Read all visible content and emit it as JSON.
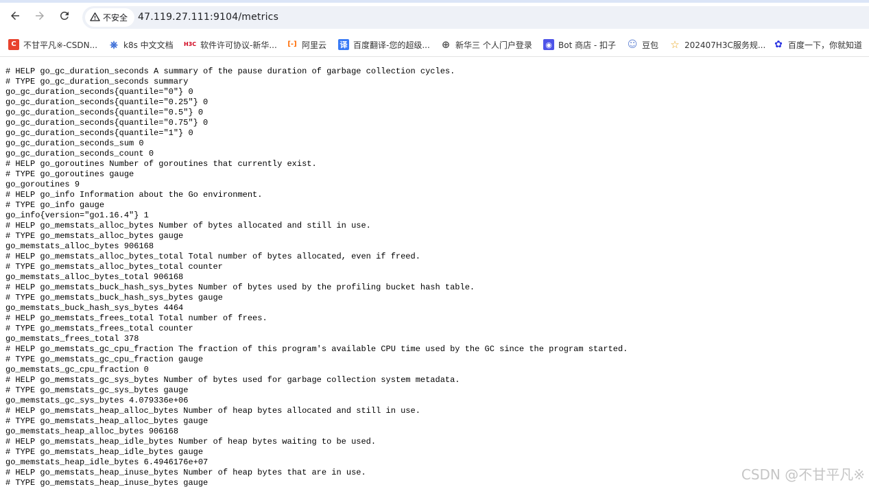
{
  "browser": {
    "back_icon": "arrow-left-icon",
    "forward_icon": "arrow-right-icon",
    "reload_icon": "reload-icon",
    "security_label": "不安全",
    "url": "47.119.27.111:9104/metrics"
  },
  "bookmarks": [
    {
      "label": "不甘平凡※-CSDN...",
      "icon": "csdn-icon",
      "glyph": "C",
      "color": "#e8432e"
    },
    {
      "label": "k8s 中文文档",
      "icon": "k8s-icon",
      "glyph": "⎈",
      "color": "#3569d6"
    },
    {
      "label": "软件许可协议-新华...",
      "icon": "h3c-icon",
      "glyph": "H3C",
      "color": "#d0021b"
    },
    {
      "label": "阿里云",
      "icon": "aliyun-icon",
      "glyph": "[-]",
      "color": "#ff6a00"
    },
    {
      "label": "百度翻译-您的超级...",
      "icon": "baidu-translate-icon",
      "glyph": "译",
      "color": "#3a7bf5"
    },
    {
      "label": "新华三 个人门户登录",
      "icon": "globe-icon",
      "glyph": "⊕",
      "color": "#555555"
    },
    {
      "label": "Bot 商店 - 扣子",
      "icon": "coze-icon",
      "glyph": "◉",
      "color": "#4d53e8"
    },
    {
      "label": "豆包",
      "icon": "doubao-icon",
      "glyph": "☺",
      "color": "#6b8bd6"
    },
    {
      "label": "202407H3C服务规...",
      "icon": "star-icon",
      "glyph": "☆",
      "color": "#e8a317"
    },
    {
      "label": "百度一下，你就知道",
      "icon": "baidu-icon",
      "glyph": "✿",
      "color": "#2932e1"
    }
  ],
  "metrics_lines": [
    "# HELP go_gc_duration_seconds A summary of the pause duration of garbage collection cycles.",
    "# TYPE go_gc_duration_seconds summary",
    "go_gc_duration_seconds{quantile=\"0\"} 0",
    "go_gc_duration_seconds{quantile=\"0.25\"} 0",
    "go_gc_duration_seconds{quantile=\"0.5\"} 0",
    "go_gc_duration_seconds{quantile=\"0.75\"} 0",
    "go_gc_duration_seconds{quantile=\"1\"} 0",
    "go_gc_duration_seconds_sum 0",
    "go_gc_duration_seconds_count 0",
    "# HELP go_goroutines Number of goroutines that currently exist.",
    "# TYPE go_goroutines gauge",
    "go_goroutines 9",
    "# HELP go_info Information about the Go environment.",
    "# TYPE go_info gauge",
    "go_info{version=\"go1.16.4\"} 1",
    "# HELP go_memstats_alloc_bytes Number of bytes allocated and still in use.",
    "# TYPE go_memstats_alloc_bytes gauge",
    "go_memstats_alloc_bytes 906168",
    "# HELP go_memstats_alloc_bytes_total Total number of bytes allocated, even if freed.",
    "# TYPE go_memstats_alloc_bytes_total counter",
    "go_memstats_alloc_bytes_total 906168",
    "# HELP go_memstats_buck_hash_sys_bytes Number of bytes used by the profiling bucket hash table.",
    "# TYPE go_memstats_buck_hash_sys_bytes gauge",
    "go_memstats_buck_hash_sys_bytes 4464",
    "# HELP go_memstats_frees_total Total number of frees.",
    "# TYPE go_memstats_frees_total counter",
    "go_memstats_frees_total 378",
    "# HELP go_memstats_gc_cpu_fraction The fraction of this program's available CPU time used by the GC since the program started.",
    "# TYPE go_memstats_gc_cpu_fraction gauge",
    "go_memstats_gc_cpu_fraction 0",
    "# HELP go_memstats_gc_sys_bytes Number of bytes used for garbage collection system metadata.",
    "# TYPE go_memstats_gc_sys_bytes gauge",
    "go_memstats_gc_sys_bytes 4.079336e+06",
    "# HELP go_memstats_heap_alloc_bytes Number of heap bytes allocated and still in use.",
    "# TYPE go_memstats_heap_alloc_bytes gauge",
    "go_memstats_heap_alloc_bytes 906168",
    "# HELP go_memstats_heap_idle_bytes Number of heap bytes waiting to be used.",
    "# TYPE go_memstats_heap_idle_bytes gauge",
    "go_memstats_heap_idle_bytes 6.4946176e+07",
    "# HELP go_memstats_heap_inuse_bytes Number of heap bytes that are in use.",
    "# TYPE go_memstats_heap_inuse_bytes gauge"
  ],
  "watermark": "CSDN @不甘平凡※"
}
